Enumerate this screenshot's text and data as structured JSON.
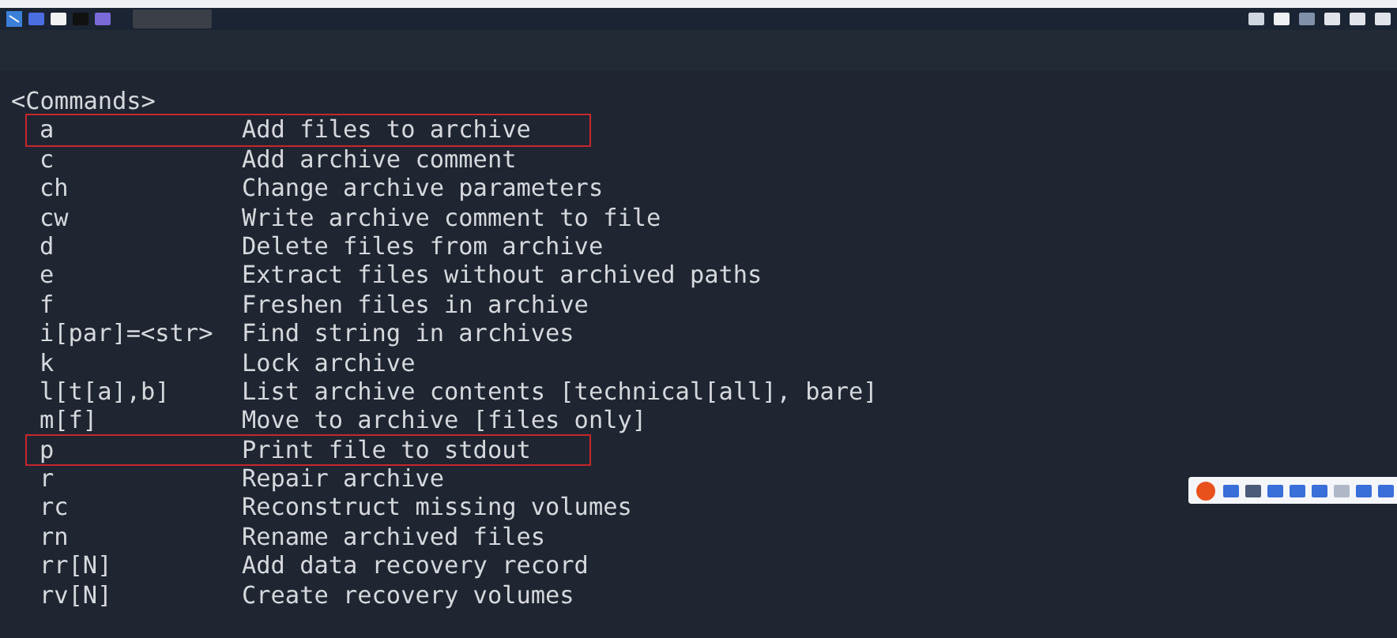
{
  "terminal": {
    "heading": "<Commands>",
    "commands": [
      {
        "key": "a",
        "description": "Add files to archive",
        "highlighted": true
      },
      {
        "key": "c",
        "description": "Add archive comment",
        "highlighted": false
      },
      {
        "key": "ch",
        "description": "Change archive parameters",
        "highlighted": false
      },
      {
        "key": "cw",
        "description": "Write archive comment to file",
        "highlighted": false
      },
      {
        "key": "d",
        "description": "Delete files from archive",
        "highlighted": false
      },
      {
        "key": "e",
        "description": "Extract files without archived paths",
        "highlighted": false
      },
      {
        "key": "f",
        "description": "Freshen files in archive",
        "highlighted": false
      },
      {
        "key": "i[par]=<str>",
        "description": "Find string in archives",
        "highlighted": false
      },
      {
        "key": "k",
        "description": "Lock archive",
        "highlighted": false
      },
      {
        "key": "l[t[a],b]",
        "description": "List archive contents [technical[all], bare]",
        "highlighted": false
      },
      {
        "key": "m[f]",
        "description": "Move to archive [files only]",
        "highlighted": false
      },
      {
        "key": "p",
        "description": "Print file to stdout",
        "highlighted": true
      },
      {
        "key": "r",
        "description": "Repair archive",
        "highlighted": false
      },
      {
        "key": "rc",
        "description": "Reconstruct missing volumes",
        "highlighted": false
      },
      {
        "key": "rn",
        "description": "Rename archived files",
        "highlighted": false
      },
      {
        "key": "rr[N]",
        "description": "Add data recovery record",
        "highlighted": false
      },
      {
        "key": "rv[N]",
        "description": "Create recovery volumes",
        "highlighted": false
      }
    ]
  }
}
